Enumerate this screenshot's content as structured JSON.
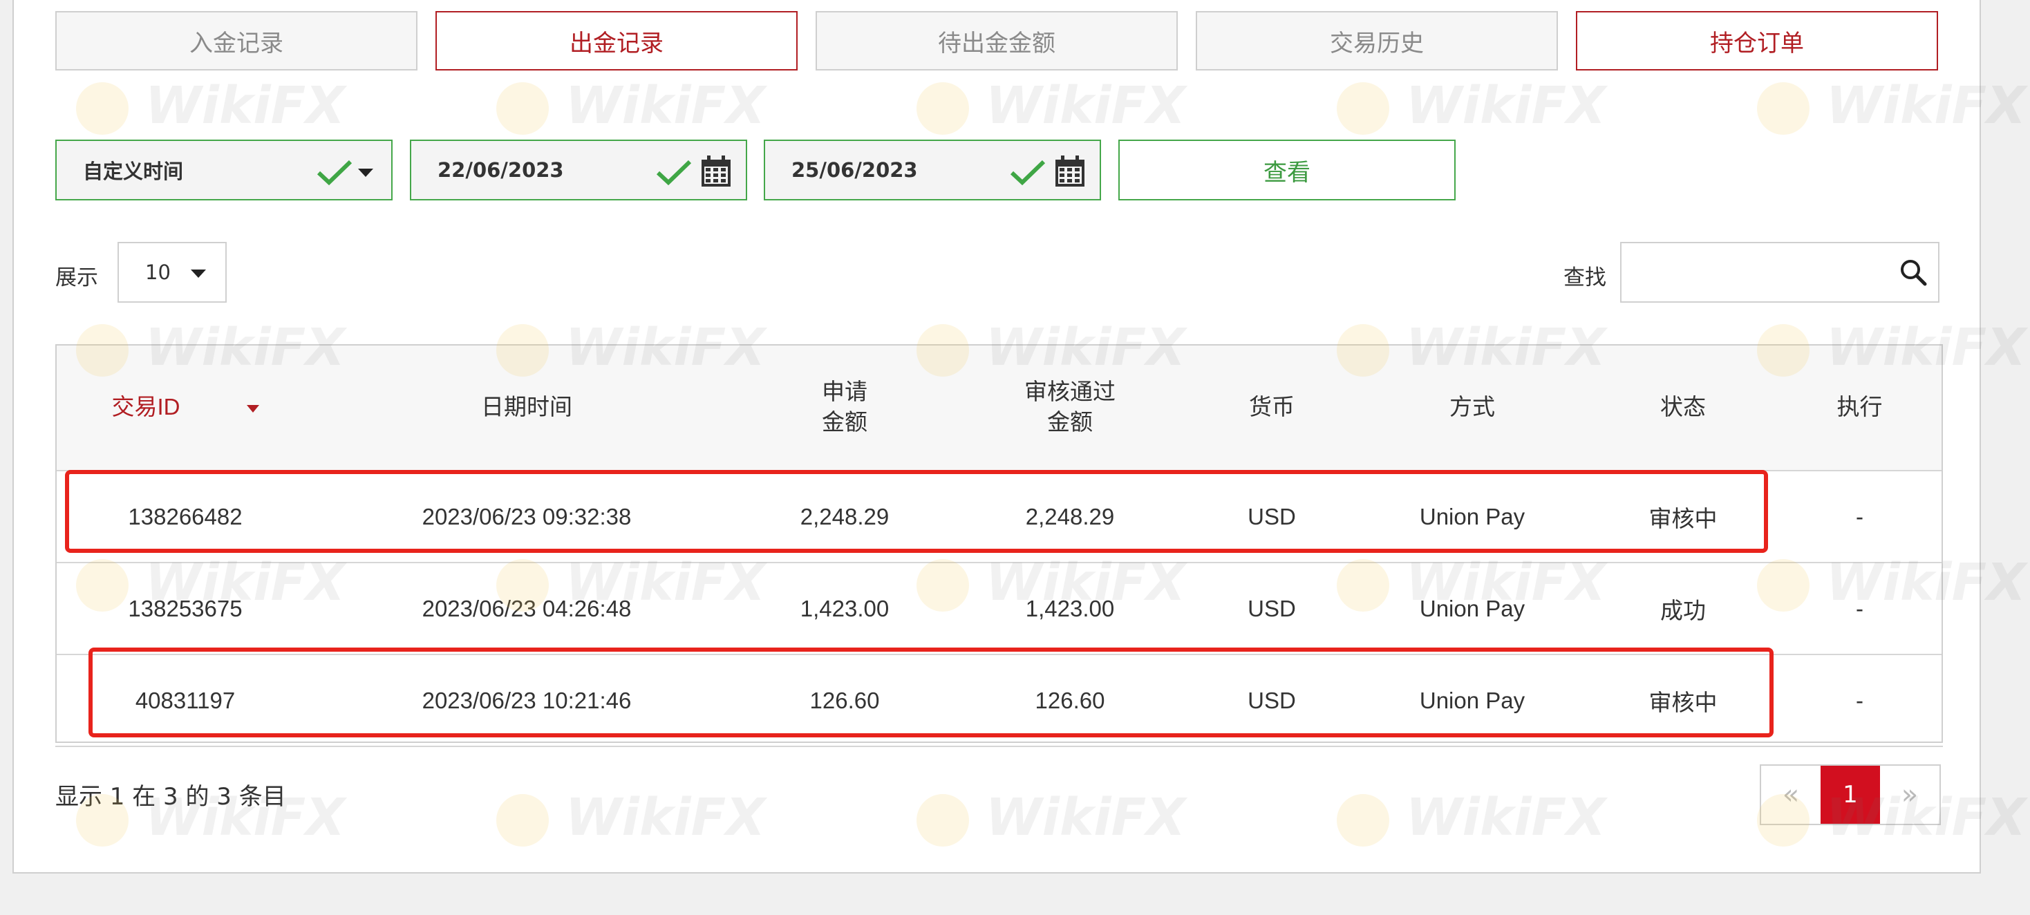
{
  "tabs": [
    {
      "label": "入金记录",
      "active": false
    },
    {
      "label": "出金记录",
      "active": true
    },
    {
      "label": "待出金金额",
      "active": false
    },
    {
      "label": "交易历史",
      "active": false
    },
    {
      "label": "持仓订单",
      "active": true
    }
  ],
  "filters": {
    "range_label": "自定义时间",
    "date_from": "22/06/2023",
    "date_to": "25/06/2023",
    "view_label": "查看"
  },
  "length": {
    "label": "展示",
    "value": "10"
  },
  "search": {
    "label": "查找",
    "value": ""
  },
  "table": {
    "headers": [
      "交易ID",
      "日期时间",
      "申请\n金额",
      "审核通过\n金额",
      "货币",
      "方式",
      "状态",
      "执行"
    ],
    "rows": [
      [
        "138266482",
        "2023/06/23 09:32:38",
        "2,248.29",
        "2,248.29",
        "USD",
        "Union Pay",
        "审核中",
        "-"
      ],
      [
        "138253675",
        "2023/06/23 04:26:48",
        "1,423.00",
        "1,423.00",
        "USD",
        "Union Pay",
        "成功",
        "-"
      ],
      [
        "40831197",
        "2023/06/23 10:21:46",
        "126.60",
        "126.60",
        "USD",
        "Union Pay",
        "审核中",
        "-"
      ]
    ]
  },
  "footer": {
    "info": "显示 1 在 3 的 3 条目"
  },
  "pagination": {
    "prev": "«",
    "current": "1",
    "next": "»"
  },
  "watermark": "WikiFX",
  "colors": {
    "accent": "#b11e23",
    "green": "#45a74a",
    "highlight": "#e8231c",
    "page_active": "#d20f1f"
  }
}
